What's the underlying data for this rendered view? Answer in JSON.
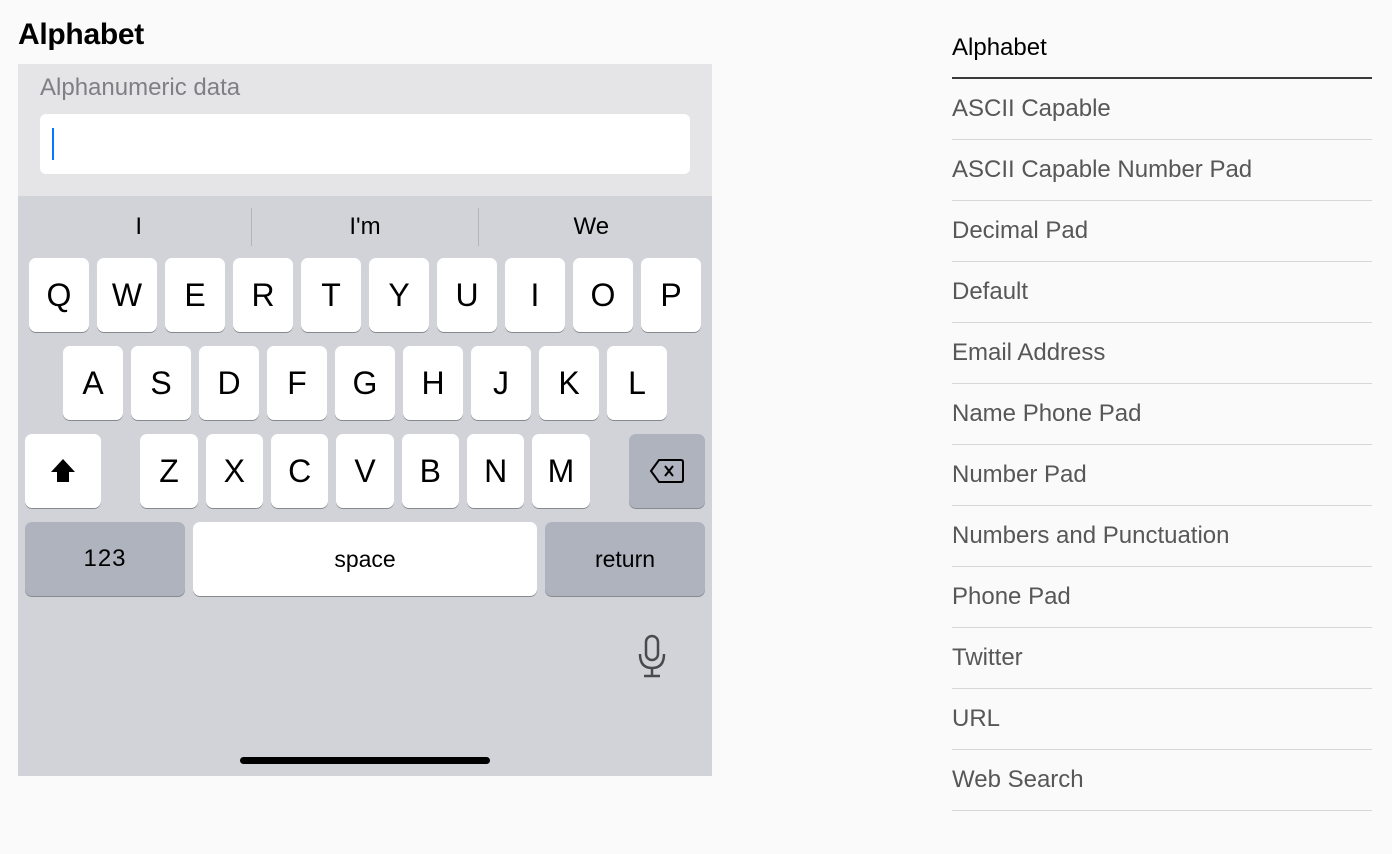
{
  "title": "Alphabet",
  "input": {
    "label": "Alphanumeric data",
    "value": ""
  },
  "suggestions": [
    "I",
    "I'm",
    "We"
  ],
  "keyboard": {
    "row1": [
      "Q",
      "W",
      "E",
      "R",
      "T",
      "Y",
      "U",
      "I",
      "O",
      "P"
    ],
    "row2": [
      "A",
      "S",
      "D",
      "F",
      "G",
      "H",
      "J",
      "K",
      "L"
    ],
    "row3": [
      "Z",
      "X",
      "C",
      "V",
      "B",
      "N",
      "M"
    ],
    "numbers_key": "123",
    "space_key": "space",
    "return_key": "return"
  },
  "sidebar": {
    "items": [
      {
        "label": "Alphabet",
        "active": true
      },
      {
        "label": "ASCII Capable",
        "active": false
      },
      {
        "label": "ASCII Capable Number Pad",
        "active": false
      },
      {
        "label": "Decimal Pad",
        "active": false
      },
      {
        "label": "Default",
        "active": false
      },
      {
        "label": "Email Address",
        "active": false
      },
      {
        "label": "Name Phone Pad",
        "active": false
      },
      {
        "label": "Number Pad",
        "active": false
      },
      {
        "label": "Numbers and Punctuation",
        "active": false
      },
      {
        "label": "Phone Pad",
        "active": false
      },
      {
        "label": "Twitter",
        "active": false
      },
      {
        "label": "URL",
        "active": false
      },
      {
        "label": "Web Search",
        "active": false
      }
    ]
  }
}
